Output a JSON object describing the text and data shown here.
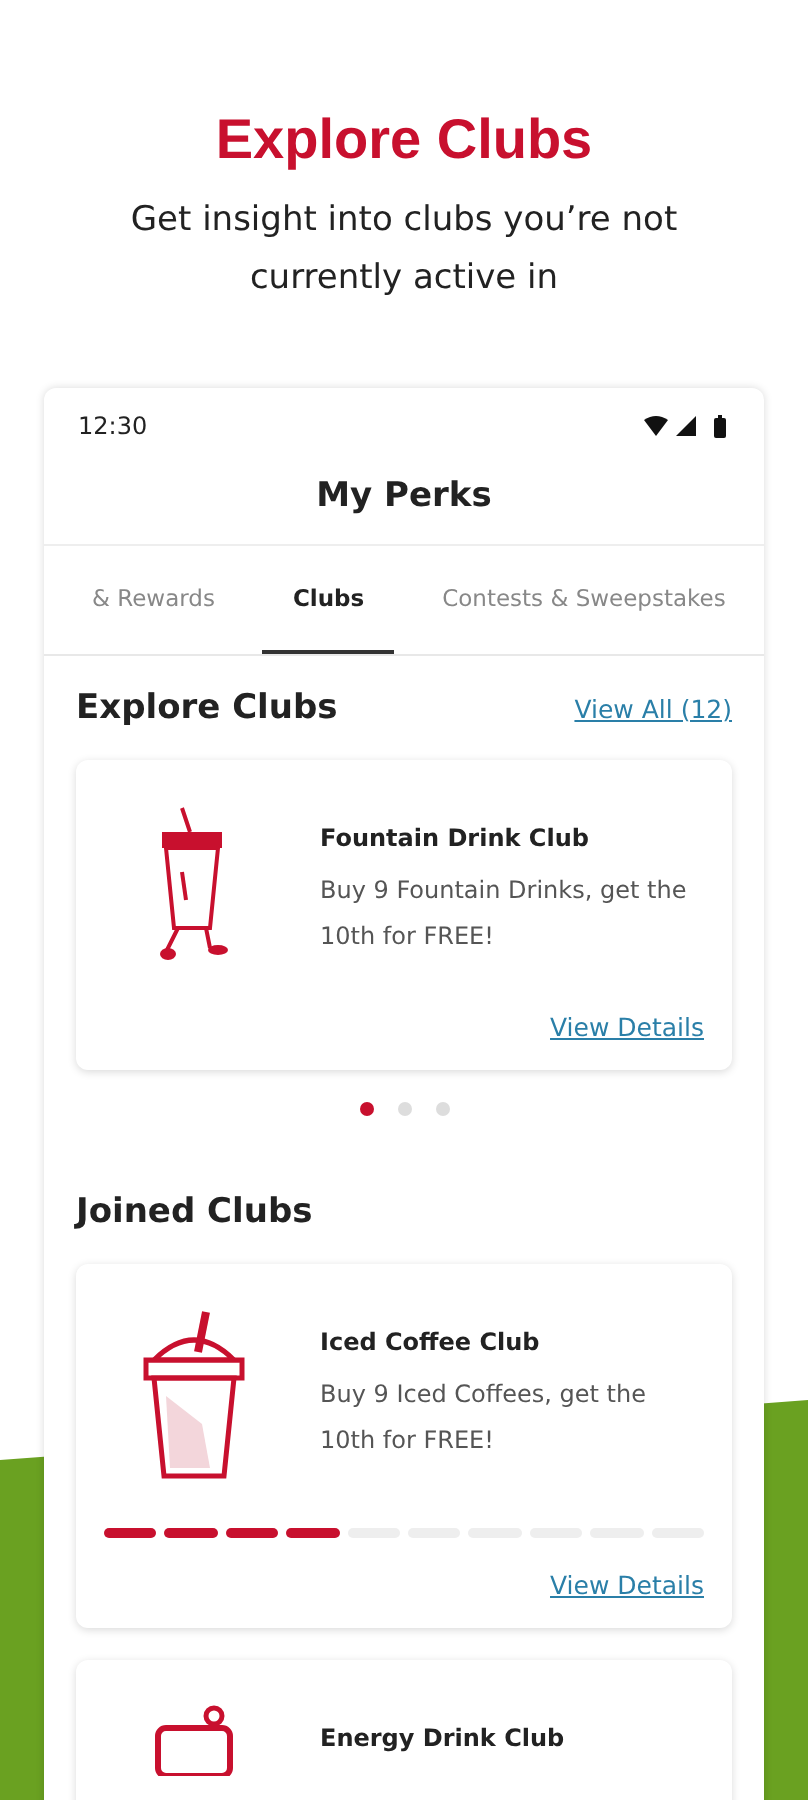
{
  "header": {
    "title": "Explore Clubs",
    "subtitle": "Get insight into clubs you’re not currently active in"
  },
  "status_bar": {
    "time": "12:30"
  },
  "app_bar": {
    "title": "My Perks"
  },
  "tabs": [
    {
      "label": "& Rewards",
      "selected": false
    },
    {
      "label": "Clubs",
      "selected": true
    },
    {
      "label": "Contests & Sweepstakes",
      "selected": false
    }
  ],
  "explore": {
    "title": "Explore Clubs",
    "link": "View All (12)",
    "cards": [
      {
        "kind": "fountain",
        "name": "Fountain Drink Club",
        "description": "Buy 9 Fountain Drinks, get the 10th for FREE!",
        "link": "View Details"
      }
    ],
    "pager": [
      {
        "selected": true
      },
      {
        "selected": false
      },
      {
        "selected": false
      }
    ]
  },
  "joined": {
    "title": "Joined Clubs",
    "cards": [
      {
        "kind": "coffee",
        "name": "Iced Coffee Club",
        "description": "Buy 9 Iced Coffees, get the 10th for FREE!",
        "level": 0.4,
        "link": "View Details"
      },
      {
        "kind": "can",
        "name": "Energy Drink Club"
      }
    ]
  }
}
